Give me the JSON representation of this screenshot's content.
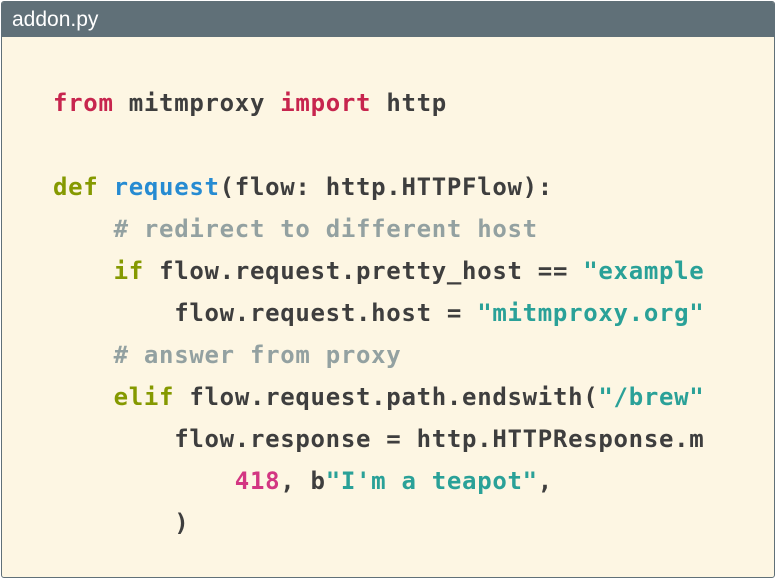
{
  "window": {
    "title": "addon.py"
  },
  "code": {
    "lines": [
      [
        {
          "t": "from",
          "c": "kw"
        },
        {
          "t": " mitmproxy ",
          "c": "txt"
        },
        {
          "t": "import",
          "c": "kw"
        },
        {
          "t": " http",
          "c": "txt"
        }
      ],
      [],
      [
        {
          "t": "def",
          "c": "kw2"
        },
        {
          "t": " ",
          "c": "txt"
        },
        {
          "t": "request",
          "c": "fn"
        },
        {
          "t": "(flow: http.HTTPFlow):",
          "c": "txt"
        }
      ],
      [
        {
          "t": "    ",
          "c": "txt"
        },
        {
          "t": "# redirect to different host",
          "c": "cm"
        }
      ],
      [
        {
          "t": "    ",
          "c": "txt"
        },
        {
          "t": "if",
          "c": "kw2"
        },
        {
          "t": " flow.request.pretty_host == ",
          "c": "txt"
        },
        {
          "t": "\"example",
          "c": "str"
        }
      ],
      [
        {
          "t": "        flow.request.host = ",
          "c": "txt"
        },
        {
          "t": "\"mitmproxy.org\"",
          "c": "str"
        }
      ],
      [
        {
          "t": "    ",
          "c": "txt"
        },
        {
          "t": "# answer from proxy",
          "c": "cm"
        }
      ],
      [
        {
          "t": "    ",
          "c": "txt"
        },
        {
          "t": "elif",
          "c": "kw2"
        },
        {
          "t": " flow.request.path.endswith(",
          "c": "txt"
        },
        {
          "t": "\"/brew\"",
          "c": "str"
        }
      ],
      [
        {
          "t": "        flow.response = http.HTTPResponse.m",
          "c": "txt"
        }
      ],
      [
        {
          "t": "            ",
          "c": "txt"
        },
        {
          "t": "418",
          "c": "num"
        },
        {
          "t": ", b",
          "c": "txt"
        },
        {
          "t": "\"I'm a teapot\"",
          "c": "str"
        },
        {
          "t": ",",
          "c": "txt"
        }
      ],
      [
        {
          "t": "        )",
          "c": "txt"
        }
      ]
    ]
  }
}
